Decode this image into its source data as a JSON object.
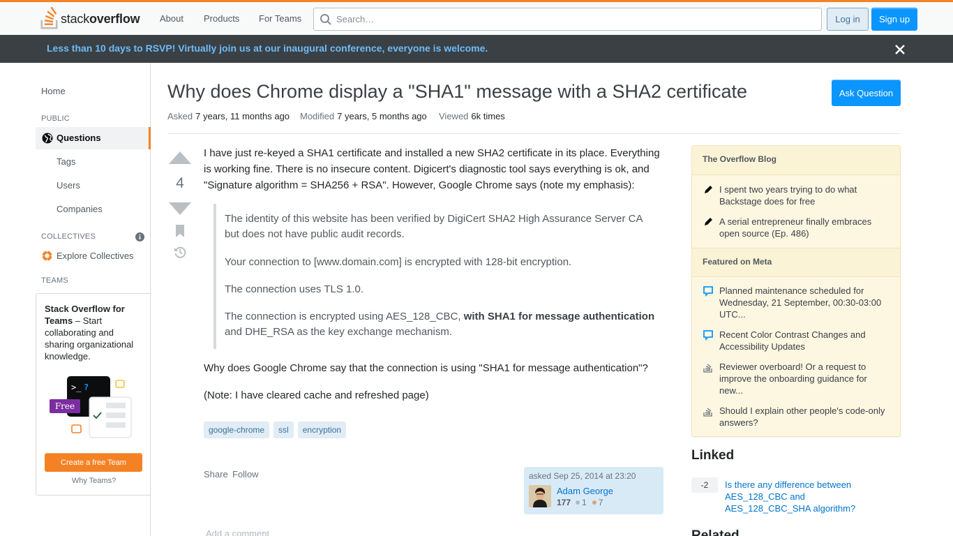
{
  "topbar": {
    "logo_light": "stack",
    "logo_bold": "overflow",
    "nav": [
      "About",
      "Products",
      "For Teams"
    ],
    "search_placeholder": "Search…",
    "login_label": "Log in",
    "signup_label": "Sign up",
    "accent_color": "#f48225"
  },
  "banner": {
    "text": "Less than 10 days to RSVP! Virtually join us at our inaugural conference, everyone is welcome."
  },
  "sidebar": {
    "home": "Home",
    "public_label": "PUBLIC",
    "questions": "Questions",
    "items": [
      "Tags",
      "Users",
      "Companies"
    ],
    "collectives_label": "COLLECTIVES",
    "explore": "Explore Collectives",
    "teams_label": "TEAMS",
    "teams_title": "Stack Overflow for Teams",
    "teams_desc": " – Start collaborating and sharing organizational knowledge.",
    "free_badge": "Free",
    "create_team": "Create a free Team",
    "why_teams": "Why Teams?"
  },
  "question": {
    "title": "Why does Chrome display a \"SHA1\" message with a SHA2 certificate",
    "ask_button": "Ask Question",
    "asked_label": "Asked",
    "asked_value": "7 years, 11 months ago",
    "modified_label": "Modified",
    "modified_value": "7 years, 5 months ago",
    "viewed_label": "Viewed",
    "viewed_value": "6k times",
    "score": "4",
    "para1": "I have just re-keyed a SHA1 certificate and installed a new SHA2 certificate in its place. Everything is working fine. There is no insecure content. Digicert's diagnostic tool says everything is ok, and \"Signature algorithm = SHA256 + RSA\". However, Google Chrome says (note my emphasis):",
    "quote1": "The identity of this website has been verified by DigiCert SHA2 High Assurance Server CA but does not have public audit records.",
    "quote2": "Your connection to [www.domain.com] is encrypted with 128-bit encryption.",
    "quote3": "The connection uses TLS 1.0.",
    "quote4_pre": "The connection is encrypted using AES_128_CBC, ",
    "quote4_bold": "with SHA1 for message authentication",
    "quote4_post": " and DHE_RSA as the key exchange mechanism.",
    "para2": "Why does Google Chrome say that the connection is using \"SHA1 for message authentication\"?",
    "para3": "(Note: I have cleared cache and refreshed page)",
    "tags": [
      "google-chrome",
      "ssl",
      "encryption"
    ],
    "share": "Share",
    "follow": "Follow",
    "asked_on": "asked Sep 25, 2014 at 23:20",
    "user_name": "Adam George",
    "user_rep": "177",
    "silver": "1",
    "bronze": "7",
    "add_comment": "Add a comment"
  },
  "right": {
    "blog_title": "The Overflow Blog",
    "blog_items": [
      {
        "icon": "pencil-icon",
        "text": "I spent two years trying to do what Backstage does for free"
      },
      {
        "icon": "pencil-icon",
        "text": "A serial entrepreneur finally embraces open source (Ep. 486)"
      }
    ],
    "meta_title": "Featured on Meta",
    "meta_items": [
      {
        "icon": "chat-bubble-icon",
        "text": "Planned maintenance scheduled for Wednesday, 21 September, 00:30-03:00 UTC..."
      },
      {
        "icon": "chat-bubble-icon",
        "text": "Recent Color Contrast Changes and Accessibility Updates"
      },
      {
        "icon": "stack-logo-icon",
        "text": "Reviewer overboard! Or a request to improve the onboarding guidance for new..."
      },
      {
        "icon": "stack-logo-icon",
        "text": "Should I explain other people's code-only answers?"
      }
    ],
    "linked_title": "Linked",
    "linked_score": "-2",
    "linked_text": "Is there any difference between AES_128_CBC and AES_128_CBC_SHA algorithm?",
    "related_title": "Related"
  }
}
